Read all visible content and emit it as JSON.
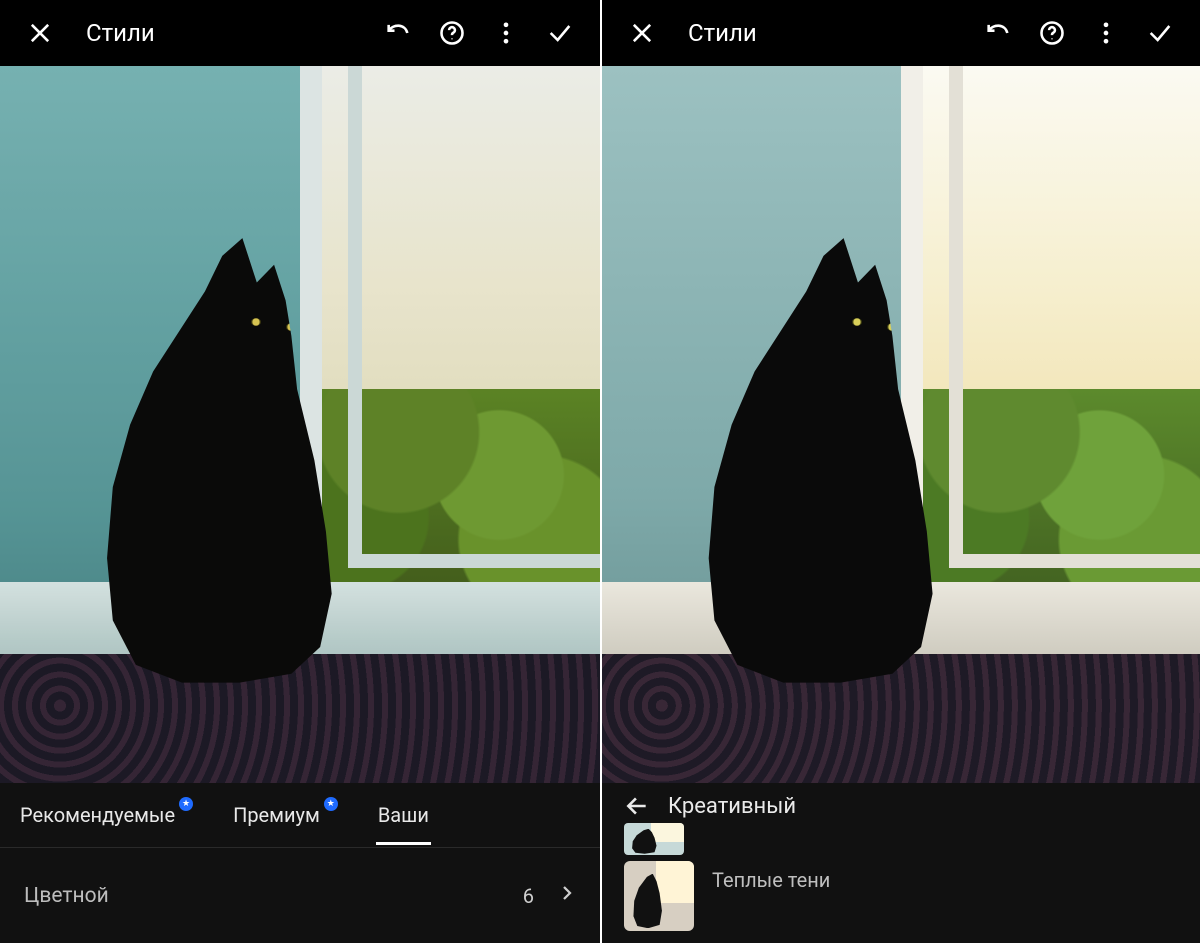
{
  "left": {
    "header": {
      "title": "Стили"
    },
    "tabs": {
      "recommended": "Рекомендуемые",
      "premium": "Премиум",
      "yours": "Ваши",
      "active": "yours"
    },
    "category_row": {
      "label": "Цветной",
      "count": "6"
    }
  },
  "right": {
    "header": {
      "title": "Стили"
    },
    "breadcrumb": {
      "label": "Креативный"
    },
    "preset": {
      "label": "Теплые тени"
    }
  },
  "icons": {
    "close": "close-icon",
    "undo": "undo-icon",
    "help": "help-icon",
    "more": "more-icon",
    "confirm": "check-icon",
    "back": "arrow-left-icon",
    "chevron": "chevron-right-icon",
    "star_badge": "star-badge-icon"
  },
  "colors": {
    "accent_badge": "#1f6bff",
    "bg": "#000000",
    "panel": "#121212",
    "text": "#ffffff",
    "muted": "#bdbdbd"
  }
}
